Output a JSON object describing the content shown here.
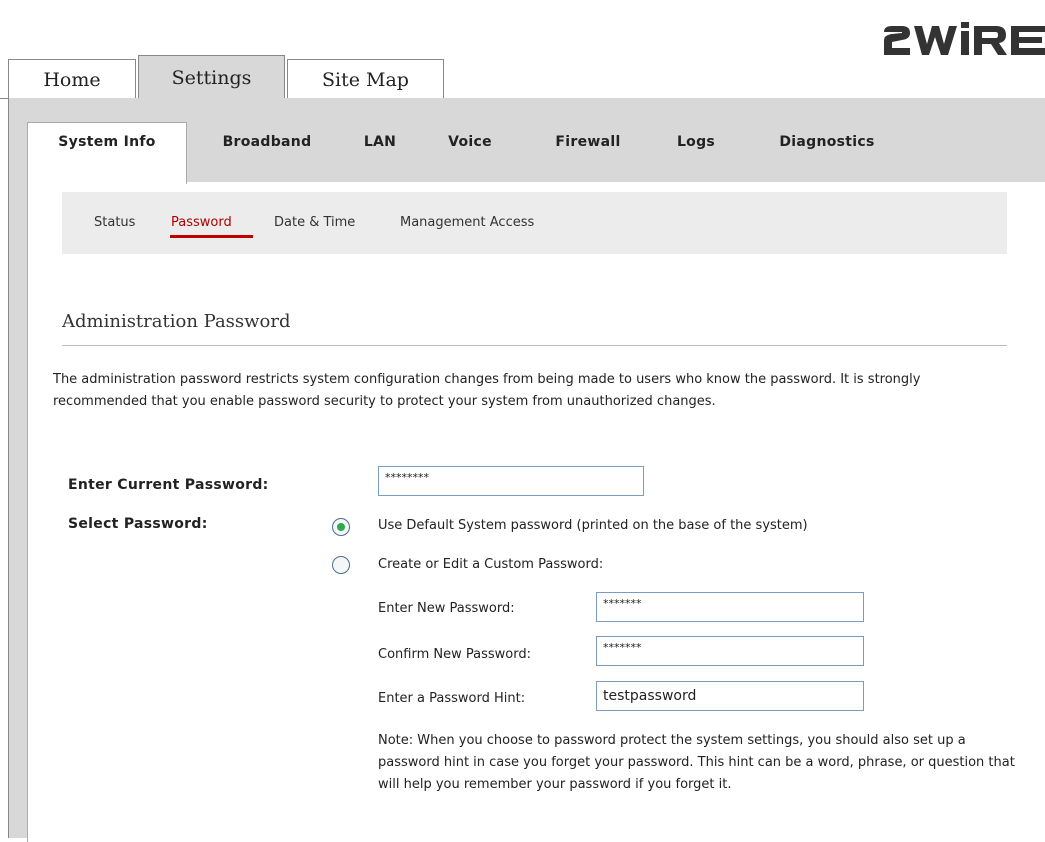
{
  "brand": {
    "logo_text": "2WIRE"
  },
  "top_tabs": [
    {
      "label": "Home"
    },
    {
      "label": "Settings"
    },
    {
      "label": "Site Map"
    }
  ],
  "sub_tabs": [
    {
      "label": "System Info"
    },
    {
      "label": "Broadband"
    },
    {
      "label": "LAN"
    },
    {
      "label": "Voice"
    },
    {
      "label": "Firewall"
    },
    {
      "label": "Logs"
    },
    {
      "label": "Diagnostics"
    }
  ],
  "subnav": [
    {
      "label": "Status"
    },
    {
      "label": "Password"
    },
    {
      "label": "Date & Time"
    },
    {
      "label": "Management Access"
    }
  ],
  "section": {
    "title": "Administration Password",
    "intro": "The administration password restricts system configuration changes from being made to users who know the password. It is strongly recommended that you enable password security to protect your system from unauthorized changes."
  },
  "form": {
    "current_password_label": "Enter Current Password:",
    "current_password_value": "********",
    "select_password_label": "Select Password:",
    "option_default_label": "Use Default System password (printed on the base of the system)",
    "option_custom_label": "Create or Edit a Custom Password:",
    "new_password_label": "Enter New Password:",
    "new_password_value": "*******",
    "confirm_password_label": "Confirm New Password:",
    "confirm_password_value": "*******",
    "hint_label": "Enter a Password Hint:",
    "hint_value": "testpassword",
    "note": "Note: When you choose to password protect the system settings, you should also set up a password hint in case you forget your password. This hint can be a word, phrase, or question that will help you remember your password if you forget it."
  },
  "colors": {
    "accent_red": "#c00000",
    "panel_gray": "#d8d8d8",
    "subnav_gray": "#ececec",
    "radio_green": "#2ea94b"
  }
}
